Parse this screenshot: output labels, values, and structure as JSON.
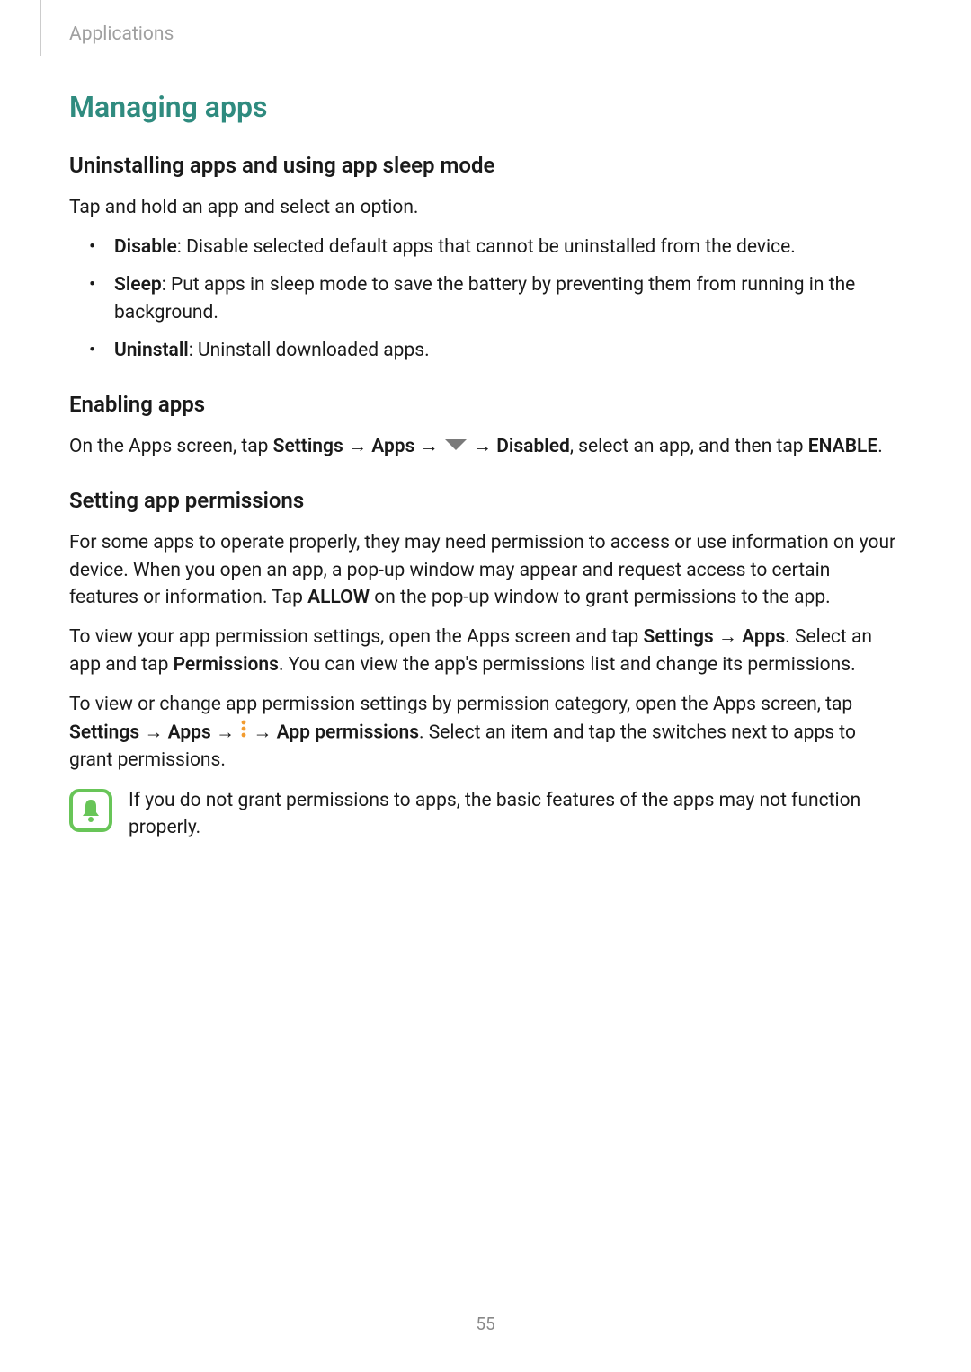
{
  "header": {
    "section": "Applications"
  },
  "title": "Managing apps",
  "h1": {
    "heading": "Uninstalling apps and using app sleep mode",
    "intro": "Tap and hold an app and select an option.",
    "bullets": [
      {
        "label": "Disable",
        "text": ": Disable selected default apps that cannot be uninstalled from the device."
      },
      {
        "label": "Sleep",
        "text": ": Put apps in sleep mode to save the battery by preventing them from running in the background."
      },
      {
        "label": "Uninstall",
        "text": ": Uninstall downloaded apps."
      }
    ]
  },
  "h2": {
    "heading": "Enabling apps",
    "p1_prefix": "On the Apps screen, tap ",
    "settings": "Settings",
    "arrow": " → ",
    "apps": "Apps",
    "disabled": "Disabled",
    "p1_suffix": ", select an app, and then tap ",
    "enable": "ENABLE",
    "period": "."
  },
  "h3": {
    "heading": "Setting app permissions",
    "p1": "For some apps to operate properly, they may need permission to access or use information on your device. When you open an app, a pop-up window may appear and request access to certain features or information. Tap ",
    "allow": "ALLOW",
    "p1_suffix": " on the pop-up window to grant permissions to the app.",
    "p2_prefix": "To view your app permission settings, open the Apps screen and tap ",
    "p2_middle": ". Select an app and tap ",
    "permissions": "Permissions",
    "p2_suffix": ". You can view the app's permissions list and change its permissions.",
    "p3_prefix": "To view or change app permission settings by permission category, open the Apps screen, tap ",
    "app_permissions": "App permissions",
    "p3_suffix": ". Select an item and tap the switches next to apps to grant permissions."
  },
  "note": {
    "text": "If you do not grant permissions to apps, the basic features of the apps may not function properly."
  },
  "page_number": "55"
}
